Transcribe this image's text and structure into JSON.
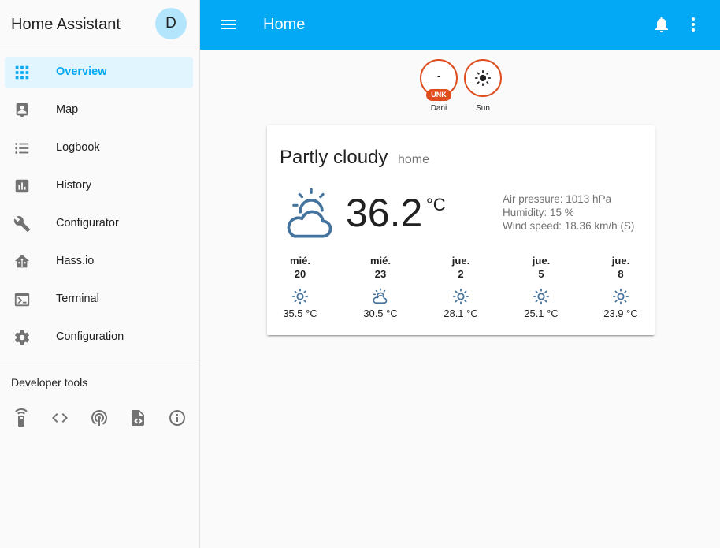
{
  "sidebar": {
    "title": "Home Assistant",
    "avatar": "D",
    "items": [
      {
        "label": "Overview",
        "icon": "view-grid-icon",
        "selected": true
      },
      {
        "label": "Map",
        "icon": "account-location-icon"
      },
      {
        "label": "Logbook",
        "icon": "format-list-bulleted-icon"
      },
      {
        "label": "History",
        "icon": "chart-box-icon"
      },
      {
        "label": "Configurator",
        "icon": "wrench-icon"
      },
      {
        "label": "Hass.io",
        "icon": "home-assistant-icon"
      },
      {
        "label": "Terminal",
        "icon": "console-icon"
      },
      {
        "label": "Configuration",
        "icon": "gear-icon"
      }
    ],
    "developer_tools": {
      "title": "Developer tools",
      "tools": [
        "remote-icon",
        "code-tags-icon",
        "radio-tower-icon",
        "file-xml-icon",
        "information-outline-icon"
      ]
    }
  },
  "header": {
    "title": "Home"
  },
  "badges": [
    {
      "name": "Dani",
      "value": "-",
      "unit": "UNK"
    },
    {
      "name": "Sun",
      "icon": "sun-icon"
    }
  ],
  "weather": {
    "condition": "Partly cloudy",
    "location": "home",
    "temperature": "36.2",
    "unit": "°C",
    "attributes": {
      "pressure": "Air pressure: 1013 hPa",
      "humidity": "Humidity: 15 %",
      "wind": "Wind speed: 18.36 km/h (S)"
    },
    "forecast": [
      {
        "day": "mié.",
        "date": "20",
        "icon": "sunny-icon",
        "temp": "35.5 °C"
      },
      {
        "day": "mié.",
        "date": "23",
        "icon": "partly-cloudy-icon",
        "temp": "30.5 °C"
      },
      {
        "day": "jue.",
        "date": "2",
        "icon": "sunny-icon",
        "temp": "28.1 °C"
      },
      {
        "day": "jue.",
        "date": "5",
        "icon": "sunny-icon",
        "temp": "25.1 °C"
      },
      {
        "day": "jue.",
        "date": "8",
        "icon": "sunny-icon",
        "temp": "23.9 °C"
      }
    ]
  },
  "colors": {
    "primary": "#03a9f4",
    "badge_accent": "#df4c1e",
    "weather_icon": "#44739e",
    "selected_bg": "#e1f5fe"
  }
}
